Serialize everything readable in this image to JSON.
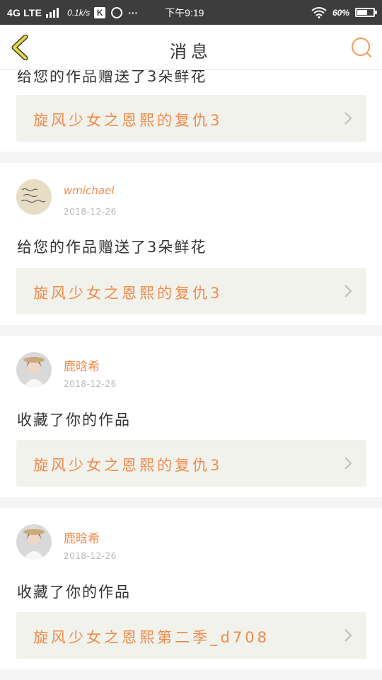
{
  "status_bar": {
    "network": "4G LTE",
    "speed": "0.1k/s",
    "k_badge": "K",
    "more": "···",
    "time": "下午9:19",
    "battery": "60%"
  },
  "nav": {
    "title": "消息",
    "back_icon": "chevron-left-icon",
    "search_icon": "search-icon"
  },
  "partial_item": {
    "message": "给您的作品赠送了3朵鲜花",
    "work_title": "旋风少女之恩熙的复仇3"
  },
  "items": [
    {
      "user": "wmichael",
      "date": "2018-12-26",
      "message": "给您的作品赠送了3朵鲜花",
      "work_title": "旋风少女之恩熙的复仇3"
    },
    {
      "user": "鹿晗希",
      "date": "2018-12-26",
      "message": "收藏了你的作品",
      "work_title": "旋风少女之恩熙的复仇3"
    },
    {
      "user": "鹿晗希",
      "date": "2018-12-26",
      "message": "收藏了你的作品",
      "work_title": "旋风少女之恩熙第二季_d708"
    }
  ],
  "colors": {
    "accent": "#f08a4b",
    "nav_back": "#c9b84a",
    "work_bg": "#f2f2ec"
  }
}
